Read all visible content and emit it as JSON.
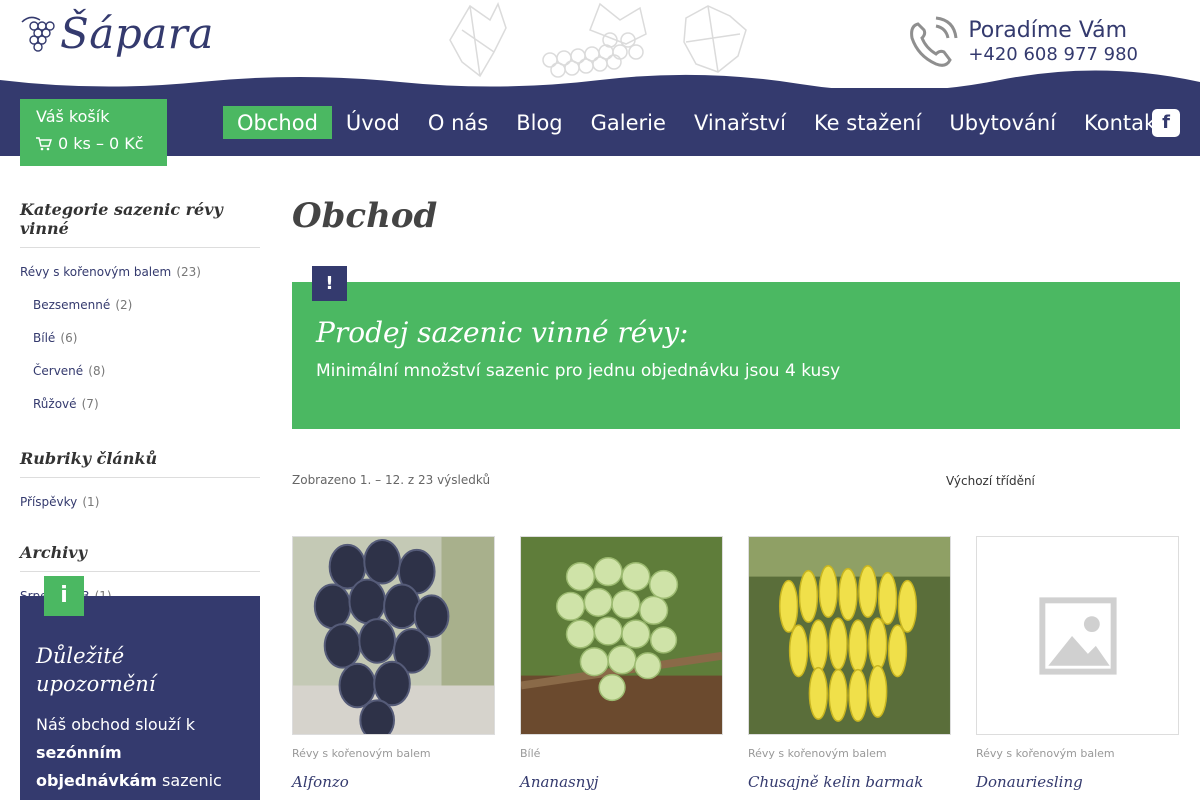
{
  "brand": {
    "name": "Šápara"
  },
  "contact": {
    "title": "Poradíme Vám",
    "phone": "+420 608 977 980"
  },
  "cart": {
    "title": "Váš košík",
    "summary": "0 ks – 0 Kč"
  },
  "nav": {
    "items": [
      "Obchod",
      "Úvod",
      "O nás",
      "Blog",
      "Galerie",
      "Vinařství",
      "Ke stažení",
      "Ubytování",
      "Kontakt"
    ],
    "active": "Obchod",
    "social": "f"
  },
  "sidebar": {
    "categories": {
      "heading": "Kategorie sazenic révy vinné",
      "top": {
        "label": "Révy s kořenovým balem",
        "count": "(23)"
      },
      "children": [
        {
          "label": "Bezsemenné",
          "count": "(2)"
        },
        {
          "label": "Bílé",
          "count": "(6)"
        },
        {
          "label": "Červené",
          "count": "(8)"
        },
        {
          "label": "Růžové",
          "count": "(7)"
        }
      ]
    },
    "rubrics": {
      "heading": "Rubriky článků",
      "items": [
        {
          "label": "Příspěvky",
          "count": "(1)"
        }
      ]
    },
    "archive": {
      "heading": "Archivy",
      "items": [
        {
          "label": "Srpen 2023",
          "count": "(1)"
        }
      ]
    },
    "notice": {
      "badge": "i",
      "title": "Důležité upozornění",
      "text_start": "Náš obchod slouží k ",
      "text_strong": "sezónním objednávkám",
      "text_end": " sazenic révy vinné."
    }
  },
  "main": {
    "title": "Obchod",
    "promo": {
      "badge": "!",
      "title": "Prodej sazenic vinné révy:",
      "text": "Minimální množství sazenic pro jednu objednávku jsou 4 kusy"
    },
    "results": "Zobrazeno 1. – 12. z 23 výsledků",
    "sorting": "Výchozí třídění",
    "products": [
      {
        "category": "Révy s kořenovým balem",
        "name": "Alfonzo",
        "image": "dark-grape-cluster"
      },
      {
        "category": "Bílé",
        "name": "Ananasnyj",
        "image": "green-grape-cluster"
      },
      {
        "category": "Révy s kořenovým balem",
        "name": "Chusajně kelin barmak",
        "image": "yellow-grape-cluster"
      },
      {
        "category": "Révy s kořenovým balem",
        "name": "Donauriesling",
        "image": "placeholder-image"
      }
    ]
  },
  "colors": {
    "navy": "#343a6e",
    "green": "#4bb862"
  }
}
